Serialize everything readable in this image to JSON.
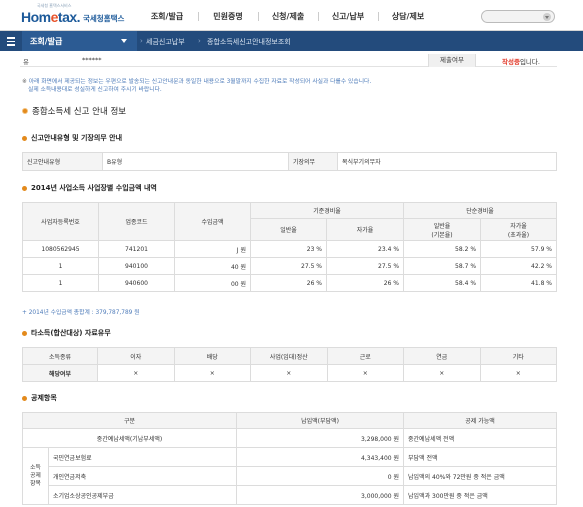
{
  "header": {
    "logo_tagline": "국세청 홈택스서비스",
    "logo_brand_left": "Hom",
    "logo_brand_dot": "e",
    "logo_brand_right": "tax.",
    "logo_agency": "국세청홈택스",
    "menu": [
      {
        "label": "조회/발급"
      },
      {
        "label": "민원증명"
      },
      {
        "label": "신청/제출"
      },
      {
        "label": "신고/납부"
      },
      {
        "label": "상담/제보"
      }
    ],
    "search_placeholder": ""
  },
  "navbar": {
    "category": "조회/발급",
    "crumbs": [
      "세금신고납부",
      "종합소득세신고안내정보조회"
    ]
  },
  "top_row": {
    "label": "유",
    "value": "******",
    "status_label": "제출여부",
    "status_value": "작성중",
    "status_suffix": "입니다."
  },
  "notice": {
    "mark": "※",
    "line1": "아래 화면에서 제공되는 정보는 우편으로 발송되는 신고안내문과 동일한 내용으로 3월말까지 수집한 자료로 작성되어 사실과 다를수 있습니다.",
    "line2": "실제 소득내용대로 성실하게 신고하여 주시기 바랍니다."
  },
  "section_main": {
    "title": "종합소득세 신고 안내 정보"
  },
  "guide": {
    "title": "신고안내유형 및 기장의무 안내",
    "type_label": "신고안내유형",
    "type_value": "B유형",
    "duty_label": "기장의무",
    "duty_value": "복식부기의무자"
  },
  "biz": {
    "title": "2014년 사업소득 사업장별 수입금액 내역",
    "headers": {
      "reg_no": "사업자등록번호",
      "industry": "업종코드",
      "revenue": "수입금액",
      "base_rate": "기준경비율",
      "simple_rate": "단순경비율",
      "general": "일반율",
      "self": "자가율",
      "general_base": "일반율",
      "general_base_sub": "(기본율)",
      "self_excess": "자가율",
      "self_excess_sub": "(초과율)"
    },
    "rows": [
      {
        "reg_no": "1080562945",
        "industry": "741201",
        "revenue": "J 원",
        "general": "23 %",
        "self": "23.4 %",
        "simple_general": "58.2 %",
        "simple_self": "57.9 %"
      },
      {
        "reg_no": "1",
        "industry": "940100",
        "revenue": "40 원",
        "general": "27.5 %",
        "self": "27.5 %",
        "simple_general": "58.7 %",
        "simple_self": "42.2 %"
      },
      {
        "reg_no": "1",
        "industry": "940600",
        "revenue": "00 원",
        "general": "26 %",
        "self": "26 %",
        "simple_general": "58.4 %",
        "simple_self": "41.8 %"
      }
    ],
    "total_note": "+ 2014년 수입금액 총합계 : 379,787,789 원"
  },
  "other": {
    "title": "타소득(합산대상) 자료유무",
    "header_label": "소득종류",
    "headers": [
      "이자",
      "배당",
      "사업(임대)정산",
      "근로",
      "연금",
      "기타"
    ],
    "row_label": "해당여부",
    "values": [
      "×",
      "×",
      "×",
      "×",
      "×",
      "×"
    ]
  },
  "deduction": {
    "title": "공제항목",
    "headers": [
      "구분",
      "납입액(부담액)",
      "공제 가능액"
    ],
    "side_label_lines": [
      "소득",
      "공제",
      "항목"
    ],
    "rows": [
      {
        "name": "중간예납세액(기납부세액)",
        "paid": "3,298,000 원",
        "limit": "중간예납세액 전액"
      },
      {
        "name": "국민연금보험료",
        "paid": "4,343,400 원",
        "limit": "부담액 전액"
      },
      {
        "name": "개인연금저축",
        "paid": "0 원",
        "limit": "납입액의 40%와 72만원 중 적은 금액"
      },
      {
        "name": "소기업소상공인공제부금",
        "paid": "3,000,000 원",
        "limit": "납입액과 300만원 중 적은 금액"
      }
    ]
  },
  "colors": {
    "navbar": "#234b7c",
    "accent": "#e38a1c",
    "notice": "#4b79b8",
    "status": "#e23a2a"
  }
}
